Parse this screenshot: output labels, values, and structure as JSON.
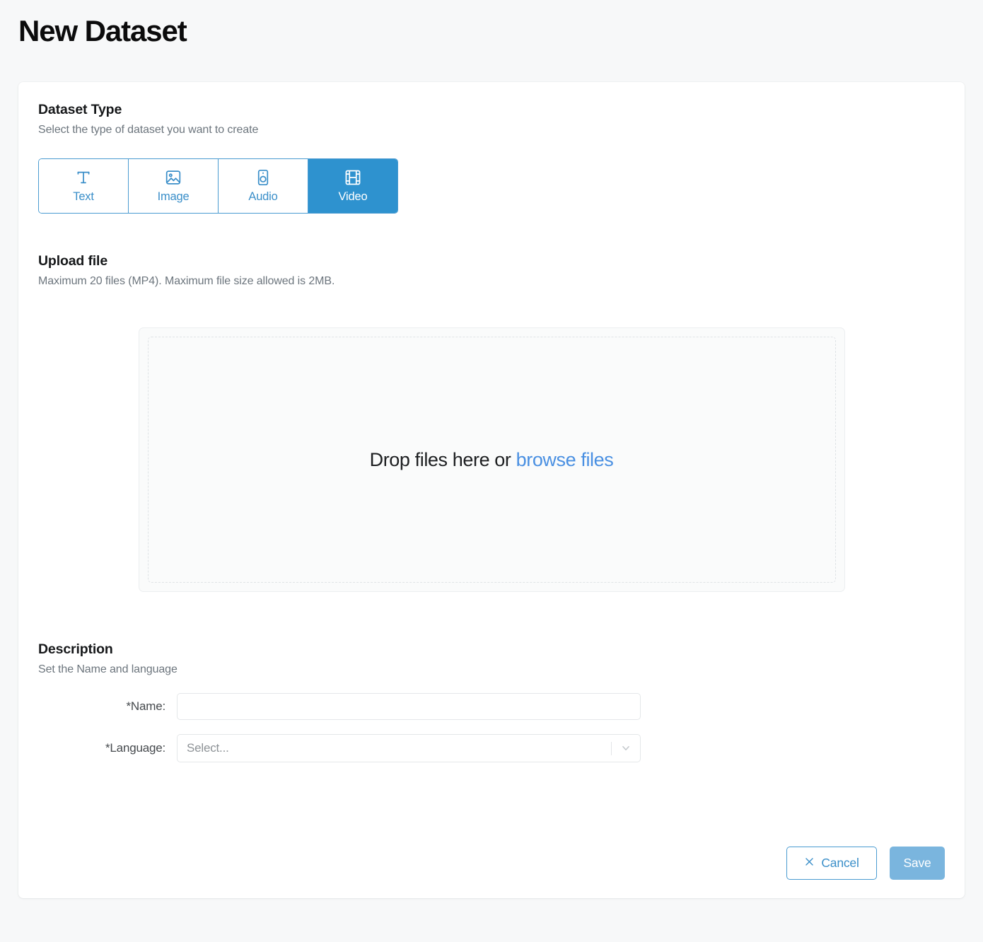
{
  "page": {
    "title": "New Dataset"
  },
  "dataset_type": {
    "heading": "Dataset Type",
    "subheading": "Select the type of dataset you want to create",
    "selected": "Video",
    "options": [
      {
        "label": "Text",
        "icon": "text-t-icon",
        "selected": false
      },
      {
        "label": "Image",
        "icon": "image-icon",
        "selected": false
      },
      {
        "label": "Audio",
        "icon": "speaker-icon",
        "selected": false
      },
      {
        "label": "Video",
        "icon": "film-strip-icon",
        "selected": true
      }
    ]
  },
  "upload": {
    "heading": "Upload file",
    "subheading": "Maximum 20 files (MP4). Maximum file size allowed is 2MB.",
    "drop_text": "Drop files here or ",
    "browse_label": "browse files",
    "max_files": 20,
    "format": "MP4",
    "max_size": "2MB"
  },
  "description": {
    "heading": "Description",
    "subheading": "Set the Name and language",
    "name_label": "*Name:",
    "name_value": "",
    "name_placeholder": "",
    "language_label": "*Language:",
    "language_value": "Select..."
  },
  "footer": {
    "cancel_label": "Cancel",
    "save_label": "Save"
  },
  "colors": {
    "accent": "#2e92cf",
    "accent_border": "#4a9bd1",
    "link": "#4a90e2",
    "save_bg": "#7ab5de",
    "page_bg": "#f7f8f9",
    "card_bg": "#ffffff",
    "muted_text": "#6c757d"
  }
}
